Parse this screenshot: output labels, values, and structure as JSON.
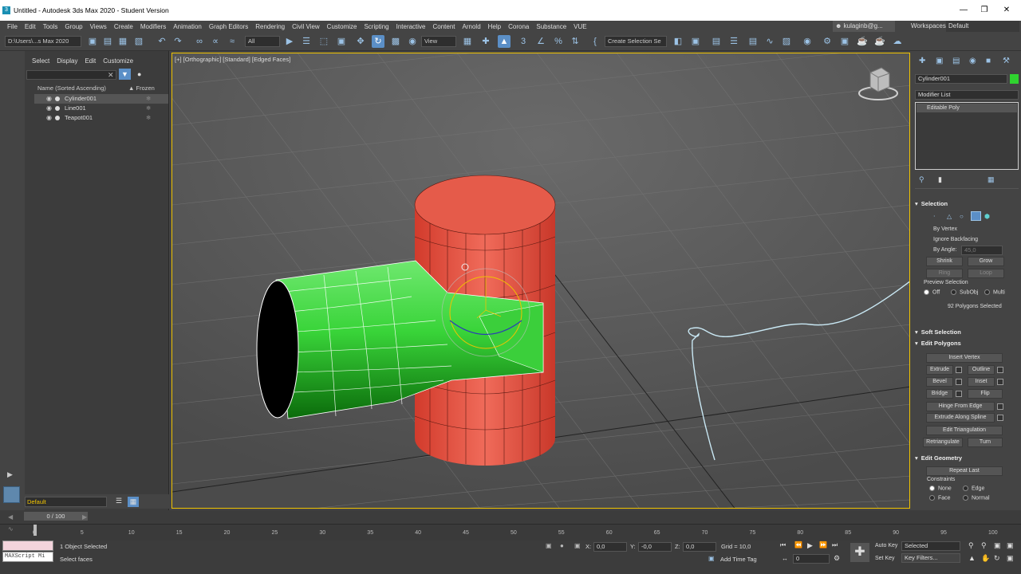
{
  "app": {
    "title": "Untitled - Autodesk 3ds Max 2020 - Student Version",
    "logo_glyph": "3"
  },
  "menus": [
    "File",
    "Edit",
    "Tools",
    "Group",
    "Views",
    "Create",
    "Modifiers",
    "Animation",
    "Graph Editors",
    "Rendering",
    "Civil View",
    "Customize",
    "Scripting",
    "Interactive",
    "Content",
    "Arnold",
    "Help",
    "Corona",
    "Substance",
    "VUE"
  ],
  "account": {
    "user": "kulaginb@g...",
    "workspace_label": "Workspaces:",
    "workspace_value": "Default"
  },
  "toolbar": {
    "project_path": "D:\\Users\\...s Max 2020",
    "selection_filter": "All",
    "ref_coord": "View",
    "named_selection_placeholder": "Create Selection Se"
  },
  "scene_explorer": {
    "tabs": [
      "Select",
      "Display",
      "Edit",
      "Customize"
    ],
    "col_name": "Name (Sorted Ascending)",
    "col_frozen": "▲ Frozen",
    "rows": [
      {
        "name": "Cylinder001",
        "selected": true
      },
      {
        "name": "Line001",
        "selected": false
      },
      {
        "name": "Teapot001",
        "selected": false
      }
    ],
    "layer": "Default"
  },
  "viewport": {
    "label": "[+] [Orthographic] [Standard] [Edged Faces]",
    "colors": {
      "cylinder": "#e55b4a",
      "selected_faces": "#2fd42f",
      "spline": "#c9e8f4",
      "border": "#f0c300"
    }
  },
  "command_panel": {
    "object_name": "Cylinder001",
    "modifier_list": "Modifier List",
    "stack_item": "Editable Poly",
    "selection": {
      "title": "Selection",
      "by_vertex": "By Vertex",
      "ignore_backfacing": "Ignore Backfacing",
      "by_angle": "By Angle:",
      "angle_value": "45,0",
      "shrink": "Shrink",
      "grow": "Grow",
      "ring": "Ring",
      "loop": "Loop",
      "preview_title": "Preview Selection",
      "preview_off": "Off",
      "preview_subobj": "SubObj",
      "preview_multi": "Multi",
      "status": "92 Polygons Selected"
    },
    "soft_selection": "Soft Selection",
    "edit_polygons": {
      "title": "Edit Polygons",
      "insert_vertex": "Insert Vertex",
      "extrude": "Extrude",
      "outline": "Outline",
      "bevel": "Bevel",
      "inset": "Inset",
      "bridge": "Bridge",
      "flip": "Flip",
      "hinge": "Hinge From Edge",
      "extrude_spline": "Extrude Along Spline",
      "edit_triangulation": "Edit Triangulation",
      "retriangulate": "Retriangulate",
      "turn": "Turn"
    },
    "edit_geometry": {
      "title": "Edit Geometry",
      "repeat_last": "Repeat Last",
      "constraints": "Constraints",
      "none": "None",
      "edge": "Edge",
      "face": "Face",
      "normal": "Normal"
    }
  },
  "timeline": {
    "frame_display": "0 / 100",
    "ticks": [
      "0",
      "5",
      "10",
      "15",
      "20",
      "25",
      "30",
      "35",
      "40",
      "45",
      "50",
      "55",
      "60",
      "65",
      "70",
      "75",
      "80",
      "85",
      "90",
      "95",
      "100"
    ]
  },
  "status": {
    "maxscript": "MAXScript Mi",
    "selected_count": "1 Object Selected",
    "prompt": "Select faces",
    "x_label": "X:",
    "x_value": "0,0",
    "y_label": "Y:",
    "y_value": "-0,0",
    "z_label": "Z:",
    "z_value": "0,0",
    "grid": "Grid = 10,0",
    "add_time_tag": "Add Time Tag",
    "auto_key": "Auto Key",
    "auto_key_mode": "Selected",
    "set_key": "Set Key",
    "key_filters": "Key Filters...",
    "current_frame": "0"
  }
}
